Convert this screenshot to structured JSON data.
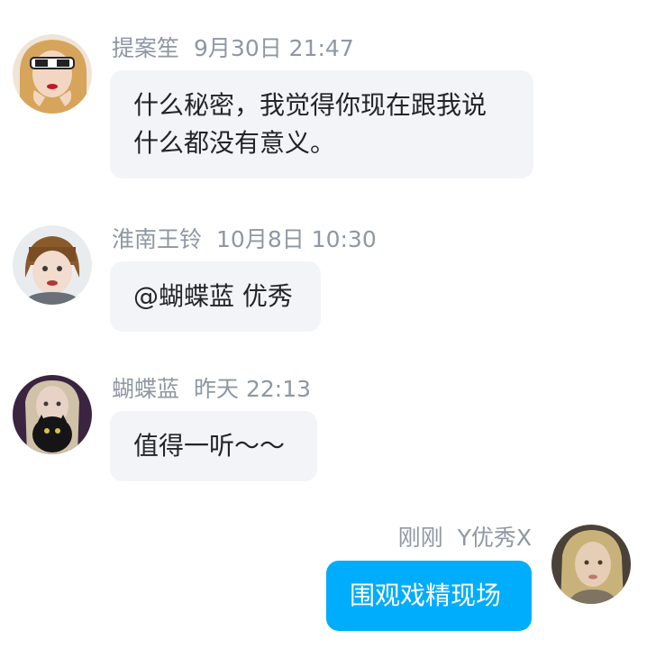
{
  "messages": [
    {
      "sender": "提案笙",
      "time": "9月30日 21:47",
      "text": "什么秘密，我觉得你现在跟我说什么都没有意义。"
    },
    {
      "sender": "淮南王铃",
      "time": "10月8日 10:30",
      "text": "@蝴蝶蓝 优秀"
    },
    {
      "sender": "蝴蝶蓝",
      "time": "昨天 22:13",
      "text": "值得一听～～"
    },
    {
      "sender": "Y优秀X",
      "time": "刚刚",
      "text": "围观戏精现场",
      "mine": true
    }
  ],
  "colors": {
    "bubble_other": "#f2f4f7",
    "bubble_mine": "#00adfc",
    "meta_text": "#8f97a3"
  }
}
